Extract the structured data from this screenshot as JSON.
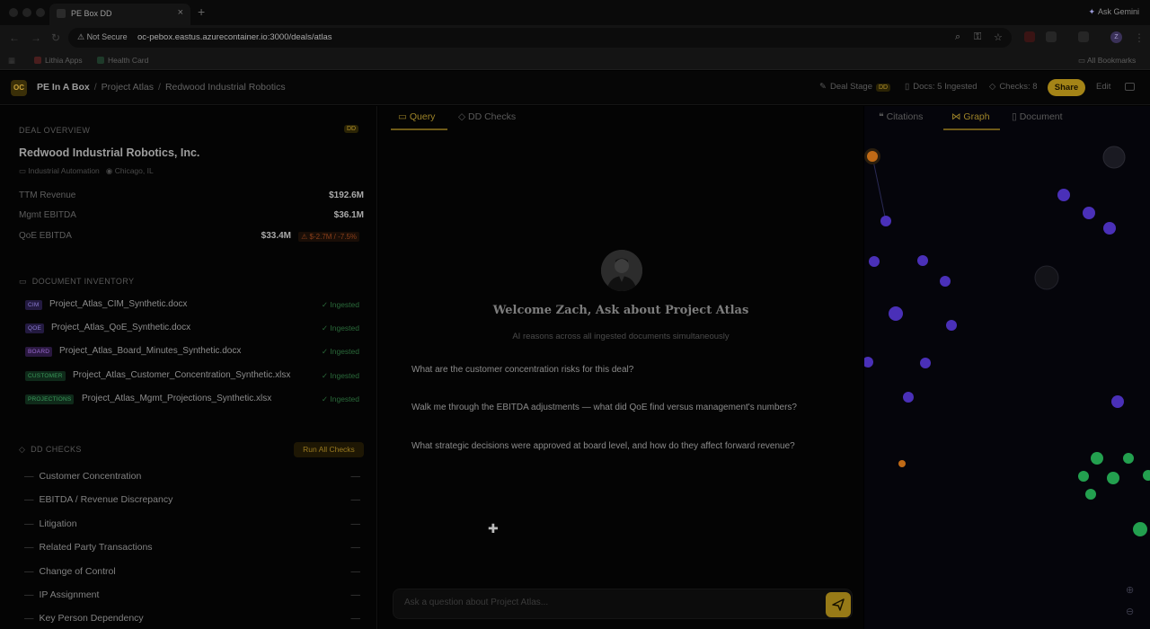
{
  "browser": {
    "tab_title": "PE Box DD",
    "tab_close": "×",
    "new_tab": "+",
    "ask_gemini": "Ask Gemini",
    "security_label": "Not Secure",
    "url": "oc-pebox.eastus.azurecontainer.io:3000/deals/atlas",
    "bookmarks": [
      "Lithia Apps",
      "Health Card"
    ],
    "all_bookmarks": "All Bookmarks",
    "profile_initial": "Z"
  },
  "header": {
    "logo": "OC",
    "breadcrumb": [
      "PE In A Box",
      "Project Atlas",
      "Redwood Industrial Robotics"
    ],
    "deal_stage_label": "Deal Stage",
    "deal_stage_value": "DD",
    "docs_label": "Docs: 5 Ingested",
    "checks_label": "Checks: 8",
    "share_label": "Share",
    "edit_label": "Edit"
  },
  "deal_overview": {
    "heading": "DEAL OVERVIEW",
    "stage_badge": "DD",
    "company": "Redwood Industrial Robotics, Inc.",
    "industry": "Industrial Automation",
    "location": "Chicago, IL",
    "metrics": [
      {
        "label": "TTM Revenue",
        "value": "$192.6M"
      },
      {
        "label": "Mgmt EBITDA",
        "value": "$36.1M"
      },
      {
        "label": "QoE EBITDA",
        "value": "$33.4M",
        "delta": "⚠ $-2.7M / -7.5%"
      }
    ]
  },
  "document_inventory": {
    "heading": "DOCUMENT INVENTORY",
    "status_label": "Ingested",
    "docs": [
      {
        "tag": "CIM",
        "name": "Project_Atlas_CIM_Synthetic.docx",
        "tag_bg": "#231a40",
        "tag_fg": "#8a7ad0"
      },
      {
        "tag": "QOE",
        "name": "Project_Atlas_QoE_Synthetic.docx",
        "tag_bg": "#231a40",
        "tag_fg": "#8a7ad0"
      },
      {
        "tag": "BOARD",
        "name": "Project_Atlas_Board_Minutes_Synthetic.docx",
        "tag_bg": "#2a1840",
        "tag_fg": "#9a6ad0"
      },
      {
        "tag": "CUSTOMER",
        "name": "Project_Atlas_Customer_Concentration_Synthetic.xlsx",
        "tag_bg": "#0f2a1a",
        "tag_fg": "#3a9a5a"
      },
      {
        "tag": "PROJECTIONS",
        "name": "Project_Atlas_Mgmt_Projections_Synthetic.xlsx",
        "tag_bg": "#0f2a1a",
        "tag_fg": "#3a9a5a"
      }
    ]
  },
  "dd_checks": {
    "heading": "DD CHECKS",
    "run_all": "Run All Checks",
    "status": "—",
    "items": [
      "Customer Concentration",
      "EBITDA / Revenue Discrepancy",
      "Litigation",
      "Related Party Transactions",
      "Change of Control",
      "IP Assignment",
      "Key Person Dependency"
    ]
  },
  "center": {
    "tabs": [
      "Query",
      "DD Checks"
    ],
    "welcome": "Welcome Zach, Ask about Project Atlas",
    "subtitle": "AI reasons across all ingested documents simultaneously",
    "suggestions": [
      "What are the customer concentration risks for this deal?",
      "Walk me through the EBITDA adjustments — what did QoE find versus management's numbers?",
      "What strategic decisions were approved at board level, and how do they affect forward revenue?"
    ],
    "input_placeholder": "Ask a question about Project Atlas..."
  },
  "right_panel": {
    "tabs": [
      "Citations",
      "Graph",
      "Document"
    ],
    "active_tab": "Graph"
  },
  "graph": {
    "colors": {
      "purple": "#5b3ce0",
      "green": "#2fbf5f",
      "orange": "#d97a1a",
      "gray": "#1c1c24",
      "edge": "#2a2a55"
    }
  }
}
